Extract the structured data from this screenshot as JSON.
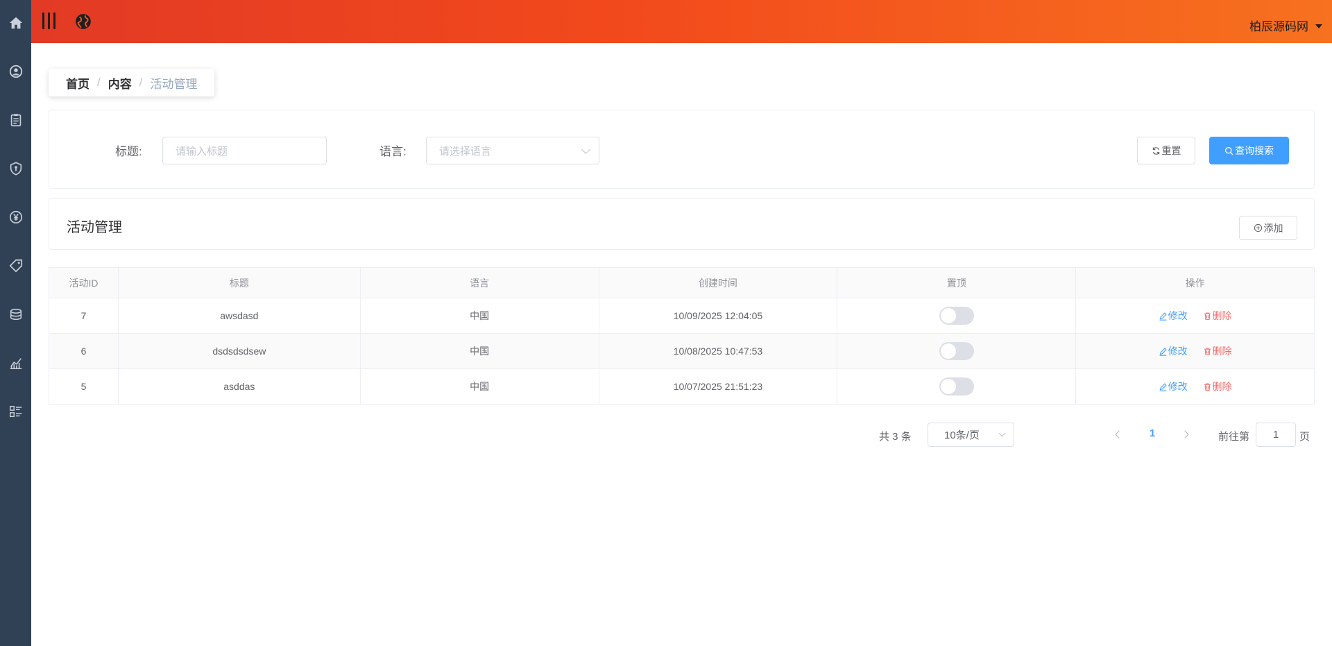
{
  "sidebar": {
    "items": [
      {
        "name": "home-icon"
      },
      {
        "name": "user-circle-icon"
      },
      {
        "name": "clipboard-icon"
      },
      {
        "name": "shield-icon"
      },
      {
        "name": "yen-icon"
      },
      {
        "name": "tag-icon"
      },
      {
        "name": "coins-icon"
      },
      {
        "name": "chart-icon"
      },
      {
        "name": "list-icon"
      }
    ]
  },
  "header": {
    "user_name": "柏辰源码网"
  },
  "breadcrumb": {
    "home": "首页",
    "separator": "/",
    "content": "内容",
    "current": "活动管理"
  },
  "filters": {
    "title_label": "标题:",
    "title_placeholder": "请输入标题",
    "lang_label": "语言:",
    "lang_placeholder": "请选择语言",
    "reset_label": "重置",
    "search_label": "查询搜索"
  },
  "section": {
    "title": "活动管理",
    "add_label": "添加"
  },
  "table": {
    "columns": [
      "活动ID",
      "标题",
      "语言",
      "创建时间",
      "置顶",
      "操作"
    ],
    "rows": [
      {
        "id": "7",
        "title": "awsdasd",
        "lang": "中国",
        "created": "10/09/2025 12:04:05",
        "pinned": false
      },
      {
        "id": "6",
        "title": "dsdsdsdsew",
        "lang": "中国",
        "created": "10/08/2025 10:47:53",
        "pinned": false
      },
      {
        "id": "5",
        "title": "asddas",
        "lang": "中国",
        "created": "10/07/2025 21:51:23",
        "pinned": false
      }
    ],
    "edit_label": "修改",
    "delete_label": "删除"
  },
  "pagination": {
    "total": "共 3 条",
    "page_size": "10条/页",
    "current_page": "1",
    "goto_label": "前往第",
    "goto_value": "1",
    "goto_unit": "页"
  },
  "colors": {
    "sidebar": "#304156",
    "header_start": "#e23a25",
    "header_end": "#f7711f",
    "primary": "#409eff",
    "danger": "#f56c6c"
  }
}
